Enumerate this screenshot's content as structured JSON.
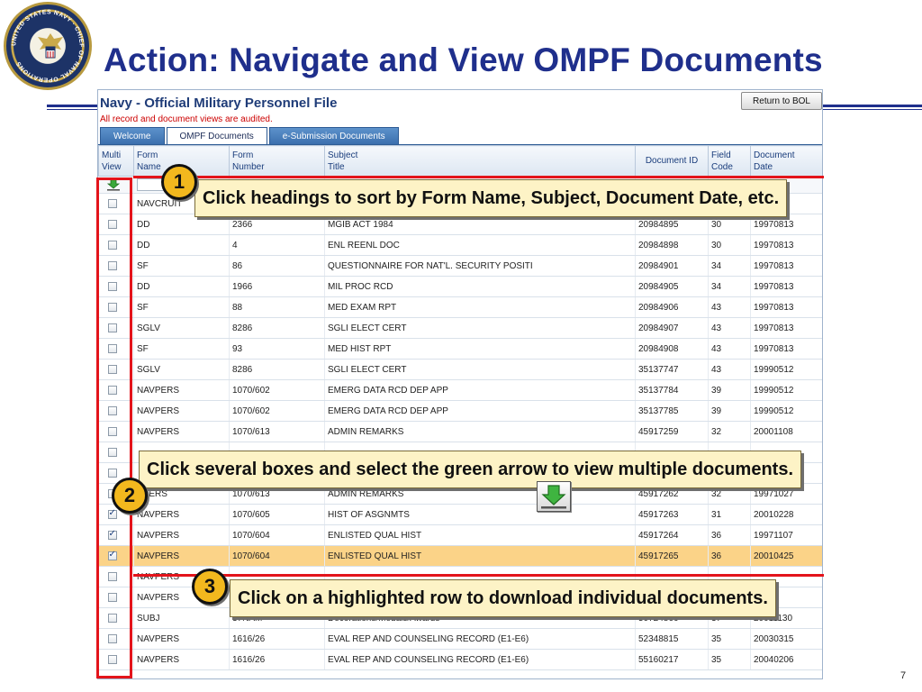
{
  "slide": {
    "title": "Action: Navigate and View OMPF Documents",
    "page_number": "7",
    "seal_ring_text": "UNITED STATES NAVY · CHIEF OF NAVAL OPERATIONS",
    "accent_color": "#1f2f8c",
    "callout_color": "#e3141b",
    "badge_color": "#f2b81e",
    "highlight_color": "#fbd388"
  },
  "app": {
    "title": "Navy - Official Military Personnel File",
    "audit_notice": "All record and document views are audited.",
    "return_button": "Return to BOL",
    "tabs": [
      {
        "label": "Welcome",
        "active": false
      },
      {
        "label": "OMPF Documents",
        "active": true
      },
      {
        "label": "e-Submission Documents",
        "active": false
      }
    ],
    "columns": {
      "multi_1": "Multi",
      "multi_2": "View",
      "form_name_1": "Form",
      "form_name_2": "Name",
      "form_number_1": "Form",
      "form_number_2": "Number",
      "subject_1": "Subject",
      "subject_2": "Title",
      "doc_id": "Document ID",
      "field_code_1": "Field",
      "field_code_2": "Code",
      "doc_date_1": "Document",
      "doc_date_2": "Date"
    },
    "rows": [
      {
        "checked": false,
        "form_name": "NAVCRUIT",
        "form_number": "",
        "subject": "",
        "doc_id": "",
        "field_code": "",
        "doc_date": ""
      },
      {
        "checked": false,
        "form_name": "DD",
        "form_number": "2366",
        "subject": "MGIB ACT 1984",
        "doc_id": "20984895",
        "field_code": "30",
        "doc_date": "19970813"
      },
      {
        "checked": false,
        "form_name": "DD",
        "form_number": "4",
        "subject": "ENL REENL DOC",
        "doc_id": "20984898",
        "field_code": "30",
        "doc_date": "19970813"
      },
      {
        "checked": false,
        "form_name": "SF",
        "form_number": "86",
        "subject": "QUESTIONNAIRE FOR NAT'L. SECURITY POSITI",
        "doc_id": "20984901",
        "field_code": "34",
        "doc_date": "19970813"
      },
      {
        "checked": false,
        "form_name": "DD",
        "form_number": "1966",
        "subject": "MIL PROC RCD",
        "doc_id": "20984905",
        "field_code": "34",
        "doc_date": "19970813"
      },
      {
        "checked": false,
        "form_name": "SF",
        "form_number": "88",
        "subject": "MED EXAM RPT",
        "doc_id": "20984906",
        "field_code": "43",
        "doc_date": "19970813"
      },
      {
        "checked": false,
        "form_name": "SGLV",
        "form_number": "8286",
        "subject": "SGLI ELECT CERT",
        "doc_id": "20984907",
        "field_code": "43",
        "doc_date": "19970813"
      },
      {
        "checked": false,
        "form_name": "SF",
        "form_number": "93",
        "subject": "MED HIST RPT",
        "doc_id": "20984908",
        "field_code": "43",
        "doc_date": "19970813"
      },
      {
        "checked": false,
        "form_name": "SGLV",
        "form_number": "8286",
        "subject": "SGLI ELECT CERT",
        "doc_id": "35137747",
        "field_code": "43",
        "doc_date": "19990512"
      },
      {
        "checked": false,
        "form_name": "NAVPERS",
        "form_number": "1070/602",
        "subject": "EMERG DATA RCD DEP APP",
        "doc_id": "35137784",
        "field_code": "39",
        "doc_date": "19990512"
      },
      {
        "checked": false,
        "form_name": "NAVPERS",
        "form_number": "1070/602",
        "subject": "EMERG DATA RCD DEP APP",
        "doc_id": "35137785",
        "field_code": "39",
        "doc_date": "19990512"
      },
      {
        "checked": false,
        "form_name": "NAVPERS",
        "form_number": "1070/613",
        "subject": "ADMIN REMARKS",
        "doc_id": "45917259",
        "field_code": "32",
        "doc_date": "20001108"
      },
      {
        "checked": false,
        "form_name": "",
        "form_number": "",
        "subject": "",
        "doc_id": "",
        "field_code": "",
        "doc_date": ""
      },
      {
        "checked": false,
        "form_name": "",
        "form_number": "",
        "subject": "",
        "doc_id": "",
        "field_code": "",
        "doc_date": ""
      },
      {
        "checked": false,
        "form_name": "VPERS",
        "form_number": "1070/613",
        "subject": "ADMIN REMARKS",
        "doc_id": "45917262",
        "field_code": "32",
        "doc_date": "19971027"
      },
      {
        "checked": true,
        "form_name": "NAVPERS",
        "form_number": "1070/605",
        "subject": "HIST OF ASGNMTS",
        "doc_id": "45917263",
        "field_code": "31",
        "doc_date": "20010228"
      },
      {
        "checked": true,
        "form_name": "NAVPERS",
        "form_number": "1070/604",
        "subject": "ENLISTED QUAL HIST",
        "doc_id": "45917264",
        "field_code": "36",
        "doc_date": "19971107"
      },
      {
        "checked": true,
        "form_name": "NAVPERS",
        "form_number": "1070/604",
        "subject": "ENLISTED QUAL HIST",
        "doc_id": "45917265",
        "field_code": "36",
        "doc_date": "20010425",
        "highlighted": true
      },
      {
        "checked": false,
        "form_name": "NAVPERS",
        "form_number": "",
        "subject": "",
        "doc_id": "",
        "field_code": "",
        "doc_date": ""
      },
      {
        "checked": false,
        "form_name": "NAVPERS",
        "form_number": "",
        "subject": "",
        "doc_id": "",
        "field_code": "",
        "doc_date": ""
      },
      {
        "checked": false,
        "form_name": "SUBJ",
        "form_number": "37NAM",
        "subject": "Decorations/Medals/Awards",
        "doc_id": "50724866",
        "field_code": "37",
        "doc_date": "20011130"
      },
      {
        "checked": false,
        "form_name": "NAVPERS",
        "form_number": "1616/26",
        "subject": "EVAL REP AND COUNSELING RECORD (E1-E6)",
        "doc_id": "52348815",
        "field_code": "35",
        "doc_date": "20030315"
      },
      {
        "checked": false,
        "form_name": "NAVPERS",
        "form_number": "1616/26",
        "subject": "EVAL REP AND COUNSELING RECORD (E1-E6)",
        "doc_id": "55160217",
        "field_code": "35",
        "doc_date": "20040206"
      }
    ]
  },
  "callouts": [
    {
      "number": "1",
      "text": "Click headings to sort by Form Name, Subject, Document Date, etc."
    },
    {
      "number": "2",
      "text": "Click several boxes and select the green arrow to view multiple documents."
    },
    {
      "number": "3",
      "text": "Click on a highlighted row to download individual documents."
    }
  ]
}
